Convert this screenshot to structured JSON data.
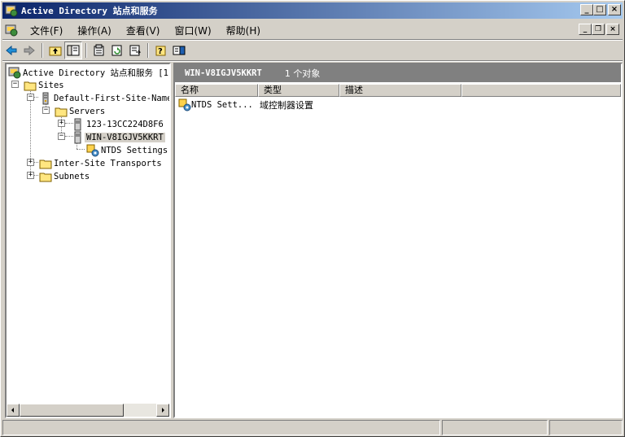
{
  "window": {
    "title": "Active Directory 站点和服务",
    "minimize": "_",
    "maximize": "□",
    "close": "×"
  },
  "menu": {
    "items": [
      "文件(F)",
      "操作(A)",
      "查看(V)",
      "窗口(W)",
      "帮助(H)"
    ],
    "mdi_minimize": "_",
    "mdi_restore": "❐",
    "mdi_close": "×"
  },
  "toolbar": {
    "buttons": [
      "back",
      "forward",
      "up-one-level",
      "show-hide-console-tree",
      "properties",
      "refresh",
      "export-list",
      "help",
      "show-hide-action-pane"
    ]
  },
  "tree": {
    "root": "Active Directory 站点和服务 [1",
    "sites": "Sites",
    "default_site": "Default-First-Site-Name",
    "servers": "Servers",
    "server1": "123-13CC224D8F6",
    "server2": "WIN-V8IGJV5KKRT",
    "ntds": "NTDS Settings",
    "inter_site": "Inter-Site Transports",
    "subnets": "Subnets",
    "expand_plus": "+",
    "expand_minus": "−"
  },
  "details": {
    "path": "WIN-V8IGJV5KKRT",
    "count": "1 个对象",
    "columns": [
      "名称",
      "类型",
      "描述"
    ],
    "rows": [
      {
        "name": "NTDS Sett...",
        "type": "域控制器设置",
        "description": ""
      }
    ]
  },
  "colors": {
    "title_start": "#0a246a",
    "title_end": "#a6caf0",
    "face": "#d4d0c8",
    "header_gray": "#808080"
  }
}
